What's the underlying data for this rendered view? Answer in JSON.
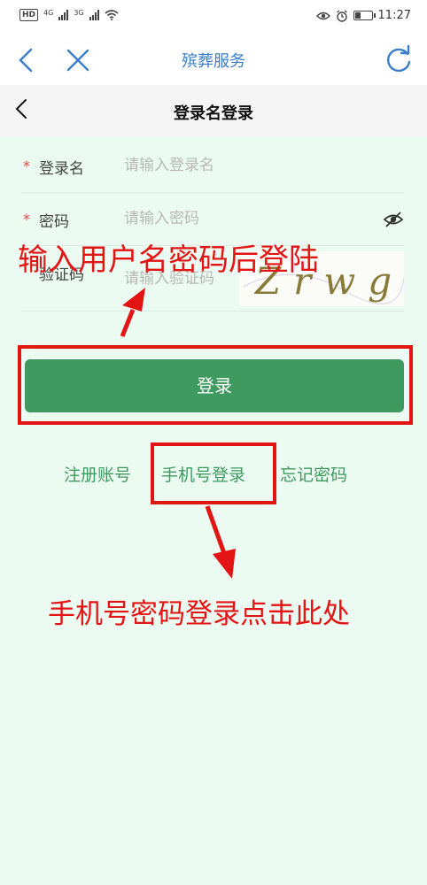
{
  "status_bar": {
    "left": [
      "HD",
      "4G",
      "3G"
    ],
    "time": "11:27",
    "icons": [
      "eye-icon",
      "alarm-icon",
      "battery-icon"
    ]
  },
  "app_bar": {
    "title": "殡葬服务",
    "icons": [
      "back-chevron-icon",
      "close-icon",
      "refresh-icon"
    ],
    "accent": "#3a7dc9"
  },
  "page_header": {
    "title": "登录名登录"
  },
  "form": {
    "username": {
      "label": "登录名",
      "placeholder": "请输入登录名",
      "required": "*"
    },
    "password": {
      "label": "密码",
      "placeholder": "请输入密码",
      "required": "*"
    },
    "captcha": {
      "label": "验证码",
      "placeholder": "请输入验证码",
      "image_text": "Zrwg"
    }
  },
  "login_button": {
    "label": "登录",
    "color": "#3f9a5f"
  },
  "links": {
    "register": "注册账号",
    "phone_login": "手机号登录",
    "forgot": "忘记密码"
  },
  "annotations": {
    "top_text": "输入用户名密码后登陆",
    "bottom_text": "手机号密码登录点击此处",
    "color": "#e31414"
  }
}
